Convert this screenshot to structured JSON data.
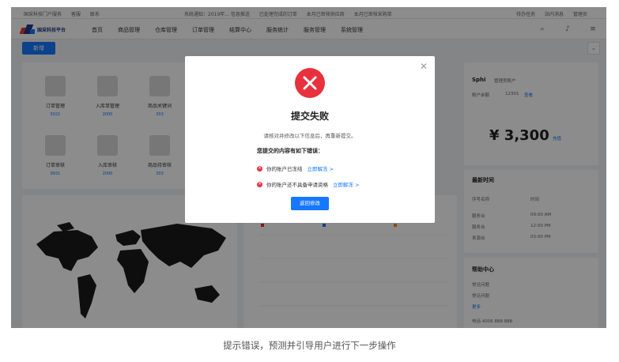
{
  "infobar": {
    "left": [
      "国采科技门户服务",
      "客服",
      "联系"
    ],
    "middle": [
      "系统通知：2019年... 信息推送",
      "已处理完成的订单",
      "本月已审核供应商",
      "本月已审核采购单"
    ],
    "right": [
      "待办任务",
      "站内消息",
      "管理员"
    ]
  },
  "nav": {
    "logo_text": "国采科技平台",
    "items": [
      "首页",
      "商品管理",
      "仓库管理",
      "订单管理",
      "结算中心",
      "服务统计",
      "服务管理",
      "系统管理"
    ],
    "icons": [
      "search-icon",
      "bell-icon",
      "menu-icon"
    ]
  },
  "toolbar": {
    "primary_label": "新增",
    "collapse_icon": "chevron-down-icon"
  },
  "quick_entries": [
    {
      "label": "订单管理",
      "count": "5021"
    },
    {
      "label": "入库单管理",
      "count": "2000"
    },
    {
      "label": "商品关键词",
      "count": "303"
    },
    {
      "label": "订单审核",
      "count": "9931"
    },
    {
      "label": "入库审核",
      "count": "2000"
    },
    {
      "label": "商品待审核",
      "count": "303"
    }
  ],
  "account": {
    "name": "Sphi",
    "tag": "管理员账户",
    "id_label": "账户余额",
    "id_value": "12301",
    "link": "查看",
    "amount": "¥ 3,300",
    "amount_link": "充值"
  },
  "messages": {
    "title": "最新时间",
    "col1": "序号名称",
    "col2": "时间",
    "rows": [
      {
        "name": "服务台",
        "time": "09:00 AM"
      },
      {
        "name": "服务台",
        "time": "12:00 PM"
      },
      {
        "name": "来源台",
        "time": "03:00 PM"
      }
    ]
  },
  "help": {
    "title": "帮助中心",
    "items": [
      "常见问题",
      "常见问题"
    ],
    "link": "更多",
    "phone": "电话 4006 888 888"
  },
  "modal": {
    "close_icon": "close-icon",
    "status_icon": "error-circle-icon",
    "title": "提交失败",
    "description": "请核对并修改以下信息后，再重新提交。",
    "subtitle": "您提交的内容有如下错误：",
    "errors": [
      {
        "text": "你的账户已冻结",
        "link": "立即解冻 >"
      },
      {
        "text": "你的账户还不具备申请资格",
        "link": "立即解冻 >"
      }
    ],
    "button_label": "返回修改"
  },
  "caption": "提示错误，预测并引导用户进行下一步操作",
  "colors": {
    "primary": "#1677ff",
    "error": "#e8313d",
    "overlay": "rgba(0,0,0,0.45)"
  }
}
